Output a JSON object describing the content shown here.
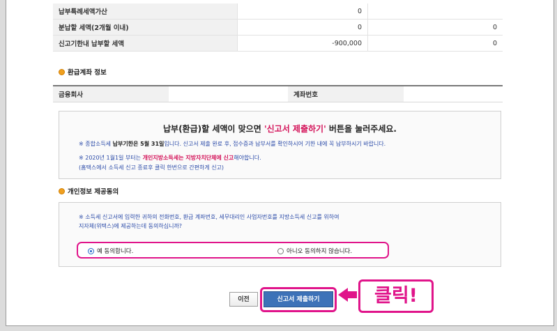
{
  "tax_rows": [
    {
      "label": "납부특례세액가산",
      "value1": "0",
      "value2": ""
    },
    {
      "label": "분납할 세액(2개월 이내)",
      "value1": "0",
      "value2": "0"
    },
    {
      "label": "신고기한내 납부할 세액",
      "value1": "-900,000",
      "value2": "0"
    }
  ],
  "refund_section": {
    "title": "환급계좌 정보",
    "bank_label": "금융회사",
    "bank_value": "",
    "account_label": "계좌번호",
    "account_value": ""
  },
  "notice": {
    "title_prefix": "납부(환급)할 세액이 맞으면 ",
    "title_highlight": "'신고서 제출하기'",
    "title_suffix": " 버튼을 눌러주세요.",
    "line1_prefix": "※ 종합소득세 ",
    "line1_bold": "납부기한은 5월 31일",
    "line1_suffix": "입니다. 신고서 제출 완료 후, 접수증과 납부서를 확인하시어 기한 내에 꼭 납부하시기 바랍니다.",
    "line2_prefix": "※ 2020년 1월1일 부터는 ",
    "line2_highlight": "개인지방소득세는 지방자치단체에 신고",
    "line2_suffix": "해야합니다.",
    "line3": "(홈택스에서 소득세 신고 종료후 클릭 한번으로 간편하게 신고)"
  },
  "consent_section": {
    "title": "개인정보 제공동의",
    "text_line1": "※ 소득세 신고서에 입력한 귀하의 전화번호, 환급 계좌번호, 세무대리인 사업자번호를 지방소득세 신고를 위하여",
    "text_line2": "지자체(위택스)에 제공하는데 동의하십니까?",
    "option_yes": "예 동의합니다.",
    "option_no": "아니오 동의하지 않습니다.",
    "selected": "yes"
  },
  "buttons": {
    "prev": "이전",
    "submit": "신고서 제출하기"
  },
  "annotation": {
    "click_label": "클릭!",
    "highlight_color": "#e0148a"
  }
}
